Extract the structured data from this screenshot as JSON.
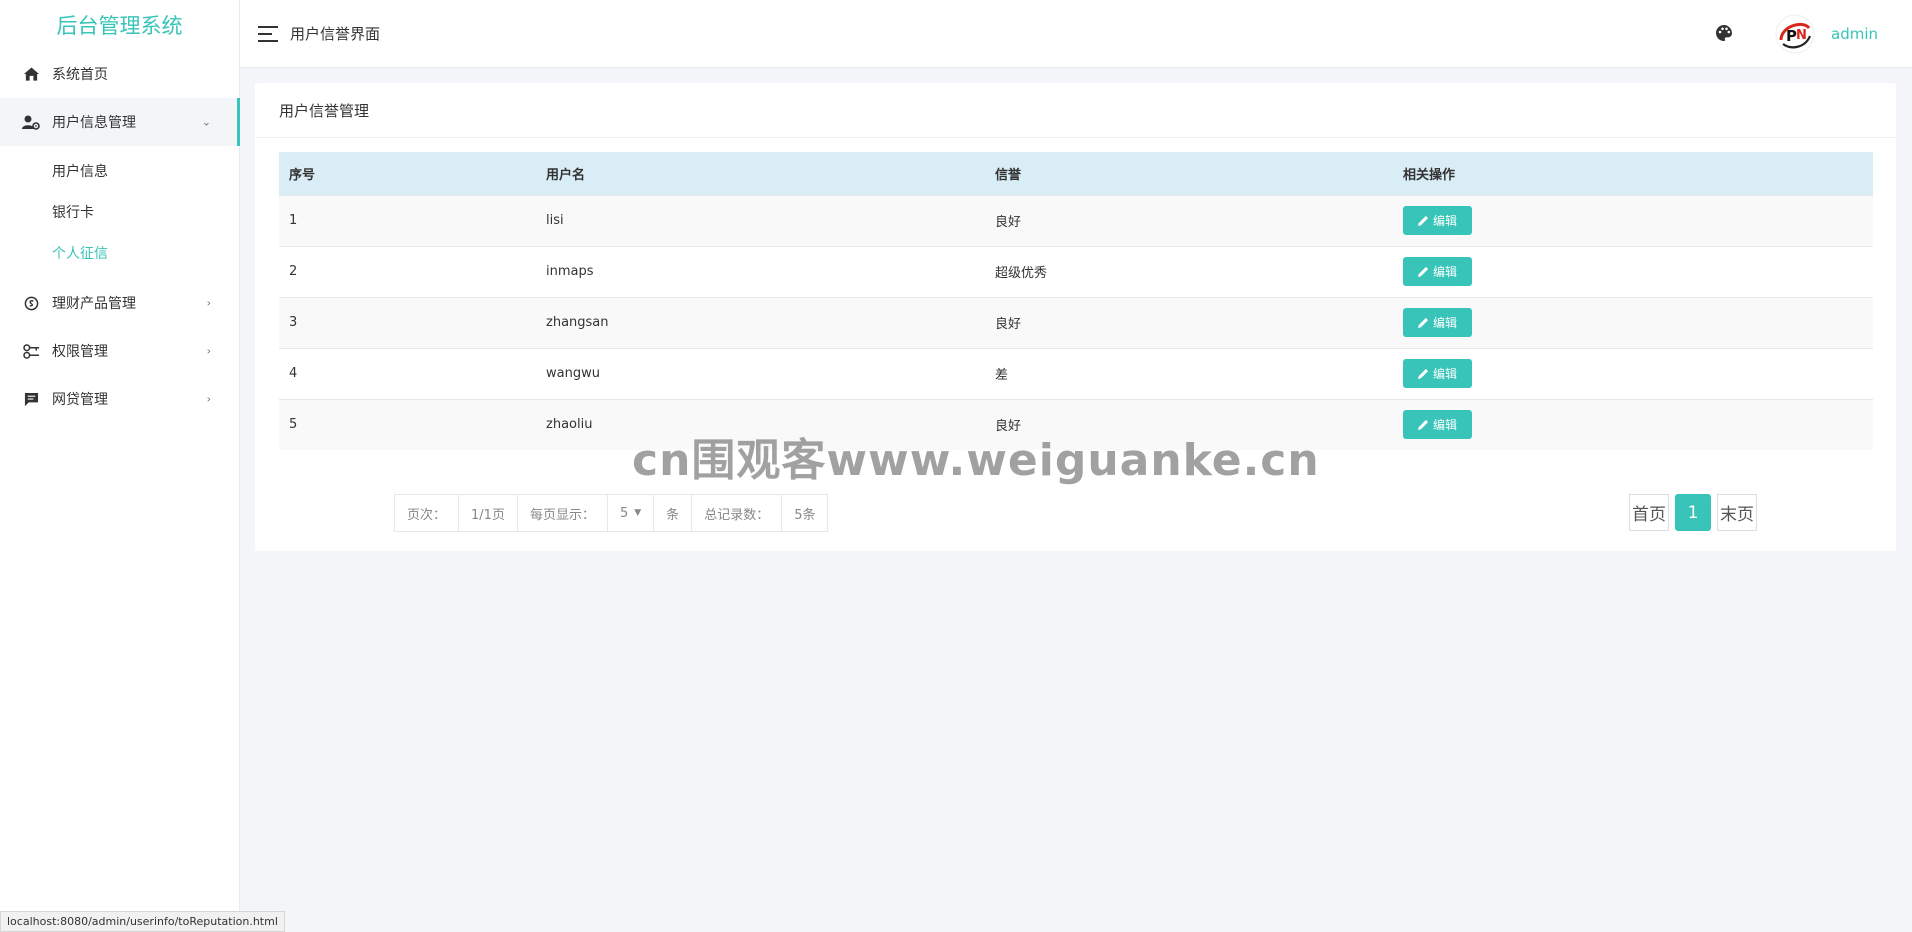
{
  "sidebar": {
    "brand": "后台管理系统",
    "items": [
      {
        "label": "系统首页",
        "icon": "home-icon"
      },
      {
        "label": "用户信息管理",
        "icon": "user-settings-icon",
        "expanded": true
      },
      {
        "label": "理财产品管理",
        "icon": "finance-icon"
      },
      {
        "label": "权限管理",
        "icon": "key-icon"
      },
      {
        "label": "网贷管理",
        "icon": "chat-icon"
      }
    ],
    "submenu": [
      {
        "label": "用户信息"
      },
      {
        "label": "银行卡"
      },
      {
        "label": "个人征信",
        "current": true
      }
    ]
  },
  "header": {
    "title": "用户信誉界面",
    "username": "admin"
  },
  "card": {
    "title": "用户信誉管理",
    "columns": [
      "序号",
      "用户名",
      "信誉",
      "相关操作"
    ],
    "rows": [
      {
        "id": "1",
        "username": "lisi",
        "reputation": "良好"
      },
      {
        "id": "2",
        "username": "inmaps",
        "reputation": "超级优秀"
      },
      {
        "id": "3",
        "username": "zhangsan",
        "reputation": "良好"
      },
      {
        "id": "4",
        "username": "wangwu",
        "reputation": "差"
      },
      {
        "id": "5",
        "username": "zhaoliu",
        "reputation": "良好"
      }
    ],
    "edit_label": "编辑"
  },
  "pager": {
    "page_label": "页次：",
    "page_value": "1/1页",
    "per_page_label": "每页显示：",
    "per_page_value": "5",
    "unit": "条",
    "total_label": "总记录数：",
    "total_value": "5条",
    "first": "首页",
    "current": "1",
    "last": "末页"
  },
  "status_url": "localhost:8080/admin/userinfo/toReputation.html",
  "watermark": "cn围观客www.weiguanke.cn",
  "colors": {
    "accent": "#38c4b8",
    "table_header": "#d9edf7"
  }
}
